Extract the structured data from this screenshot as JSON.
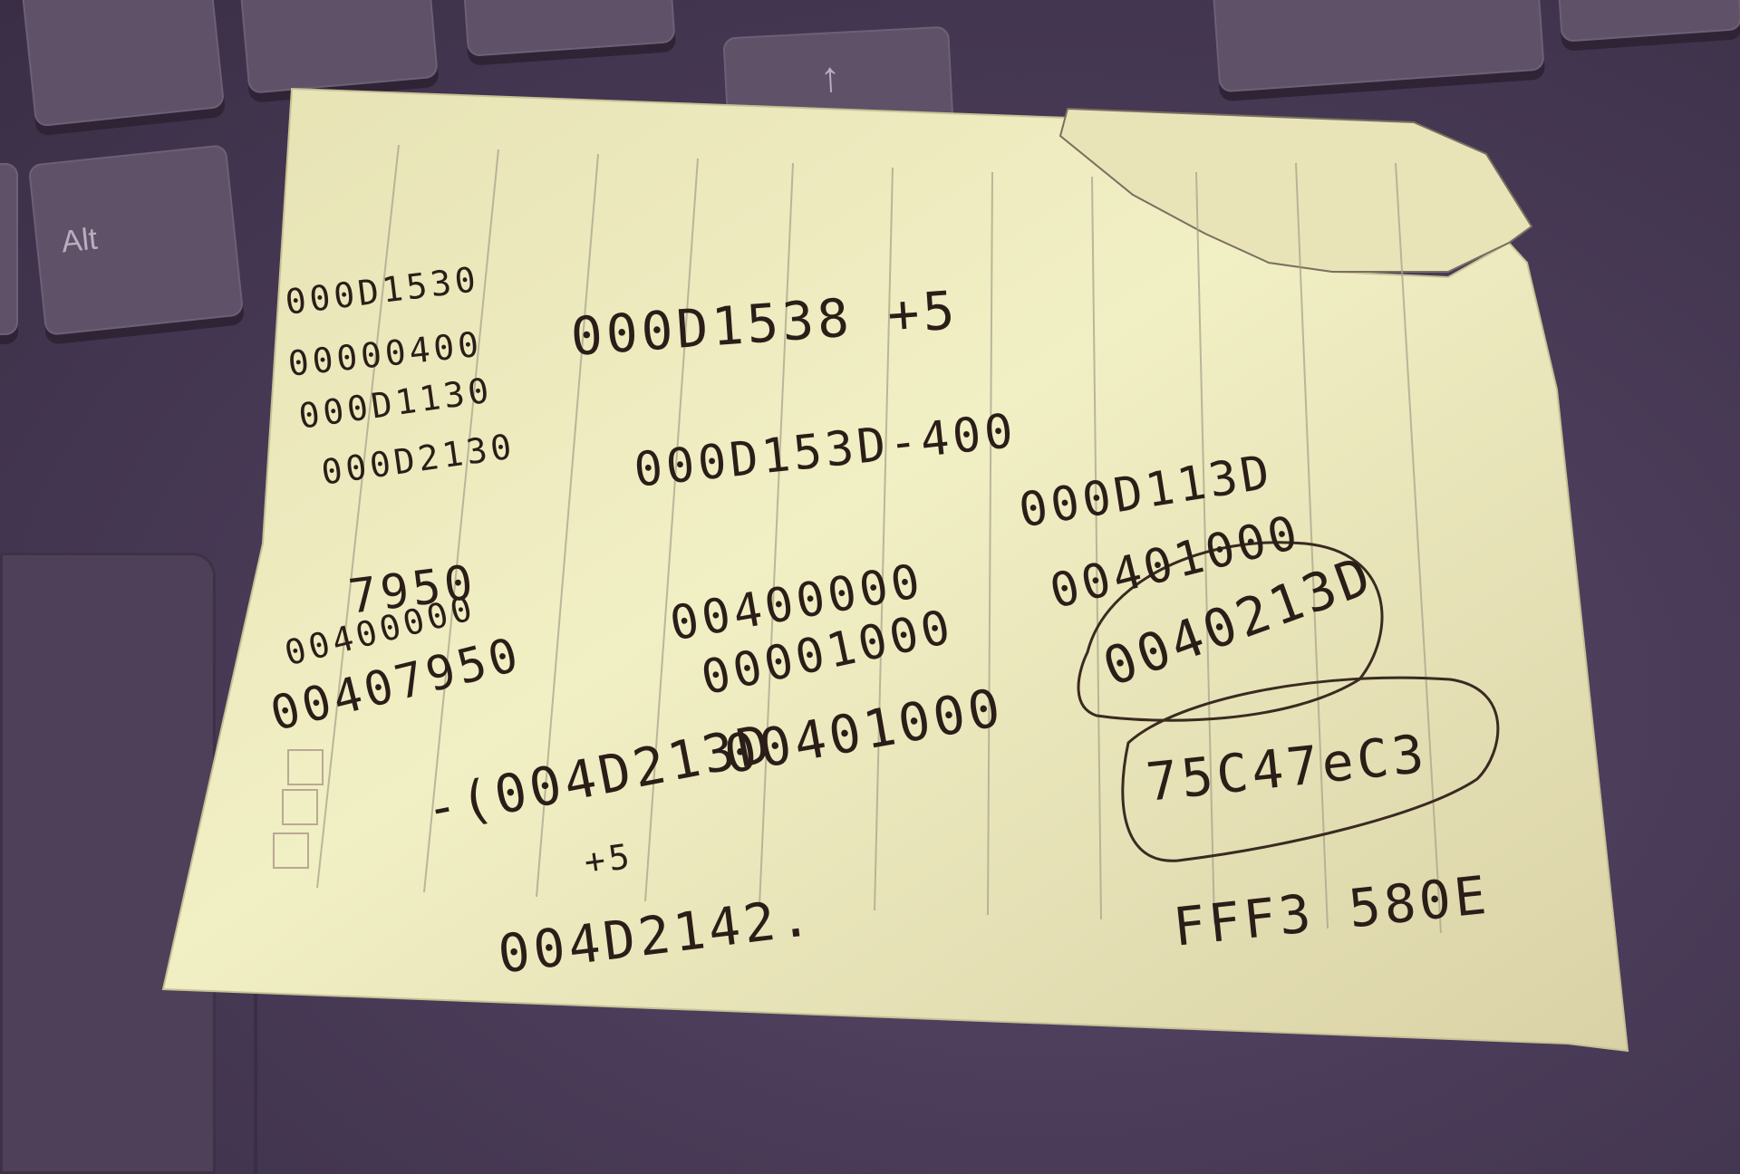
{
  "keyboard": {
    "alt_key_label": "Alt",
    "arrow_key_label": "↑"
  },
  "note": {
    "left_column": [
      "000D1530",
      "00000400",
      "000D1130",
      "000D2130",
      "7950",
      "00400000",
      "00407950"
    ],
    "middle": {
      "line1": "000D1538 +5",
      "line2": "000D153D-400",
      "sum_a": "00400000",
      "sum_b": "00001000",
      "sum_result": "00401000",
      "bracket_value": "-(004D213D",
      "plus": "+5",
      "result": "004D2142."
    },
    "right": {
      "line1": "000D113D",
      "line2": "00401000",
      "circled_1": "0040213D",
      "circled_2": "75C47eC3",
      "bottom": "FFF3 580E"
    }
  }
}
